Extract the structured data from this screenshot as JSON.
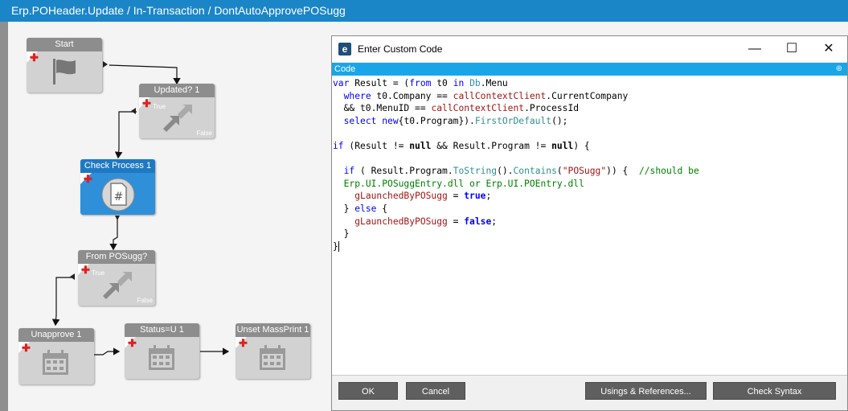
{
  "window": {
    "title": "Erp.POHeader.Update / In-Transaction / DontAutoApprovePOSugg"
  },
  "workflow": {
    "nodes": [
      {
        "key": "start",
        "label": "Start",
        "icon": "flag-icon"
      },
      {
        "key": "updated",
        "label": "Updated? 1",
        "icon": "condition-arrow-icon",
        "true_label": "True",
        "false_label": "False"
      },
      {
        "key": "check-process",
        "label": "Check Process 1",
        "icon": "custom-code-icon",
        "selected": true
      },
      {
        "key": "from-posugg",
        "label": "From POSugg?",
        "icon": "condition-arrow-icon",
        "true_label": "True",
        "false_label": "False"
      },
      {
        "key": "unapprove",
        "label": "Unapprove 1",
        "icon": "calendar-icon"
      },
      {
        "key": "status-u",
        "label": "Status=U 1",
        "icon": "calendar-icon"
      },
      {
        "key": "unset-massprint",
        "label": "Unset MassPrint 1",
        "icon": "calendar-icon"
      }
    ]
  },
  "dialog": {
    "title": "Enter Custom Code",
    "section_label": "Code",
    "minimize": "—",
    "maximize": "☐",
    "close": "✕",
    "buttons": {
      "ok": "OK",
      "cancel": "Cancel",
      "usings": "Usings & References...",
      "check_syntax": "Check Syntax"
    }
  },
  "colors": {
    "accent": "#1a86c8",
    "code_header": "#1aa6e6",
    "selected_node": "#2f8fd8",
    "node": "#d2d2d2",
    "button": "#5f5f5f"
  }
}
